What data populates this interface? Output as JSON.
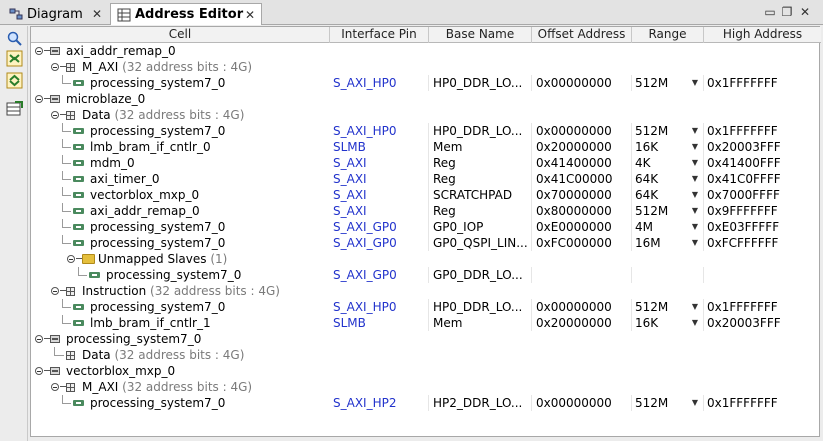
{
  "tabs": [
    {
      "label": "Diagram",
      "icon": "diagram-icon"
    },
    {
      "label": "Address Editor",
      "icon": "address-editor-icon"
    }
  ],
  "toolbar": [
    "search-icon",
    "collapse-all-icon",
    "expand-all-icon",
    "auto-assign-address-icon"
  ],
  "columns": [
    "Cell",
    "Interface Pin",
    "Base Name",
    "Offset Address",
    "Range",
    "High Address"
  ],
  "rows": [
    {
      "label": "axi_addr_remap_0",
      "type": "master",
      "depth": 0
    },
    {
      "label": "M_AXI",
      "sub": "(32 address bits : 4G)",
      "type": "space",
      "depth": 1
    },
    {
      "label": "processing_system7_0",
      "type": "slave",
      "depth": 2,
      "pin": "S_AXI_HP0",
      "base": "HP0_DDR_LO...",
      "offset": "0x00000000",
      "range": "512M",
      "high": "0x1FFFFFFF"
    },
    {
      "label": "microblaze_0",
      "type": "master",
      "depth": 0
    },
    {
      "label": "Data",
      "sub": "(32 address bits : 4G)",
      "type": "space",
      "depth": 1
    },
    {
      "label": "processing_system7_0",
      "type": "slave",
      "depth": 2,
      "pin": "S_AXI_HP0",
      "base": "HP0_DDR_LO...",
      "offset": "0x00000000",
      "range": "512M",
      "high": "0x1FFFFFFF"
    },
    {
      "label": "lmb_bram_if_cntlr_0",
      "type": "slave",
      "depth": 2,
      "pin": "SLMB",
      "base": "Mem",
      "offset": "0x20000000",
      "range": "16K",
      "high": "0x20003FFF"
    },
    {
      "label": "mdm_0",
      "type": "slave",
      "depth": 2,
      "pin": "S_AXI",
      "base": "Reg",
      "offset": "0x41400000",
      "range": "4K",
      "high": "0x41400FFF"
    },
    {
      "label": "axi_timer_0",
      "type": "slave",
      "depth": 2,
      "pin": "S_AXI",
      "base": "Reg",
      "offset": "0x41C00000",
      "range": "64K",
      "high": "0x41C0FFFF"
    },
    {
      "label": "vectorblox_mxp_0",
      "type": "slave",
      "depth": 2,
      "pin": "S_AXI",
      "base": "SCRATCHPAD",
      "offset": "0x70000000",
      "range": "64K",
      "high": "0x7000FFFF"
    },
    {
      "label": "axi_addr_remap_0",
      "type": "slave",
      "depth": 2,
      "pin": "S_AXI",
      "base": "Reg",
      "offset": "0x80000000",
      "range": "512M",
      "high": "0x9FFFFFFF"
    },
    {
      "label": "processing_system7_0",
      "type": "slave",
      "depth": 2,
      "pin": "S_AXI_GP0",
      "base": "GP0_IOP",
      "offset": "0xE0000000",
      "range": "4M",
      "high": "0xE03FFFFF"
    },
    {
      "label": "processing_system7_0",
      "type": "slave",
      "depth": 2,
      "pin": "S_AXI_GP0",
      "base": "GP0_QSPI_LIN...",
      "offset": "0xFC000000",
      "range": "16M",
      "high": "0xFCFFFFFF"
    },
    {
      "label": "Unmapped Slaves",
      "sub": "(1)",
      "type": "folder",
      "depth": 2
    },
    {
      "label": "processing_system7_0",
      "type": "slave",
      "depth": 3,
      "pin": "S_AXI_GP0",
      "base": "GP0_DDR_LO...",
      "offset": "",
      "range": "",
      "high": ""
    },
    {
      "label": "Instruction",
      "sub": "(32 address bits : 4G)",
      "type": "space",
      "depth": 1
    },
    {
      "label": "processing_system7_0",
      "type": "slave",
      "depth": 2,
      "pin": "S_AXI_HP0",
      "base": "HP0_DDR_LO...",
      "offset": "0x00000000",
      "range": "512M",
      "high": "0x1FFFFFFF"
    },
    {
      "label": "lmb_bram_if_cntlr_1",
      "type": "slave",
      "depth": 2,
      "pin": "SLMB",
      "base": "Mem",
      "offset": "0x20000000",
      "range": "16K",
      "high": "0x20003FFF"
    },
    {
      "label": "processing_system7_0",
      "type": "master",
      "depth": 0
    },
    {
      "label": "Data",
      "sub": "(32 address bits : 4G)",
      "type": "space-leaf",
      "depth": 1
    },
    {
      "label": "vectorblox_mxp_0",
      "type": "master",
      "depth": 0
    },
    {
      "label": "M_AXI",
      "sub": "(32 address bits : 4G)",
      "type": "space",
      "depth": 1
    },
    {
      "label": "processing_system7_0",
      "type": "slave",
      "depth": 2,
      "pin": "S_AXI_HP2",
      "base": "HP2_DDR_LO...",
      "offset": "0x00000000",
      "range": "512M",
      "high": "0x1FFFFFFF"
    }
  ]
}
